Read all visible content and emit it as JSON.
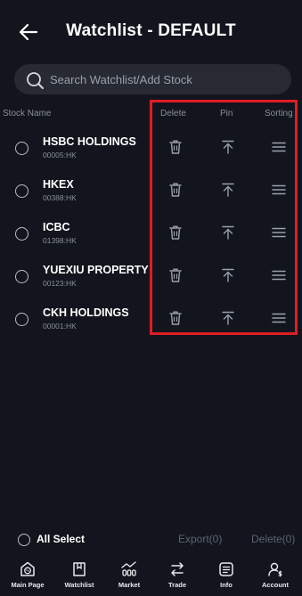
{
  "header": {
    "title": "Watchlist - DEFAULT",
    "back_icon": "back-arrow-icon"
  },
  "search": {
    "placeholder": "Search Watchlist/Add Stock",
    "value": "",
    "icon": "search-icon"
  },
  "columns": {
    "stock_name": "Stock Name",
    "delete": "Delete",
    "pin": "Pin",
    "sorting": "Sorting"
  },
  "stocks": [
    {
      "name": "HSBC HOLDINGS",
      "code": "00005:HK"
    },
    {
      "name": "HKEX",
      "code": "00388:HK"
    },
    {
      "name": "ICBC",
      "code": "01398:HK"
    },
    {
      "name": "YUEXIU PROPERTY",
      "code": "00123:HK"
    },
    {
      "name": "CKH HOLDINGS",
      "code": "00001:HK"
    }
  ],
  "row_actions": {
    "delete_icon": "trash-icon",
    "pin_icon": "pin-to-top-icon",
    "sorting_icon": "drag-handle-icon"
  },
  "select_bar": {
    "all_select": "All Select",
    "export": "Export(0)",
    "delete": "Delete(0)"
  },
  "bottom_nav": [
    {
      "label": "Main Page",
      "icon": "home-icon"
    },
    {
      "label": "Watchlist",
      "icon": "watchlist-icon"
    },
    {
      "label": "Market",
      "icon": "market-icon"
    },
    {
      "label": "Trade",
      "icon": "trade-icon"
    },
    {
      "label": "Info",
      "icon": "info-icon"
    },
    {
      "label": "Account",
      "icon": "account-icon"
    }
  ],
  "colors": {
    "background": "#12151d",
    "search_bg": "#272a33",
    "highlight_border": "#e21c24",
    "muted_text": "#8a8f99",
    "disabled_text": "#5d6370"
  }
}
